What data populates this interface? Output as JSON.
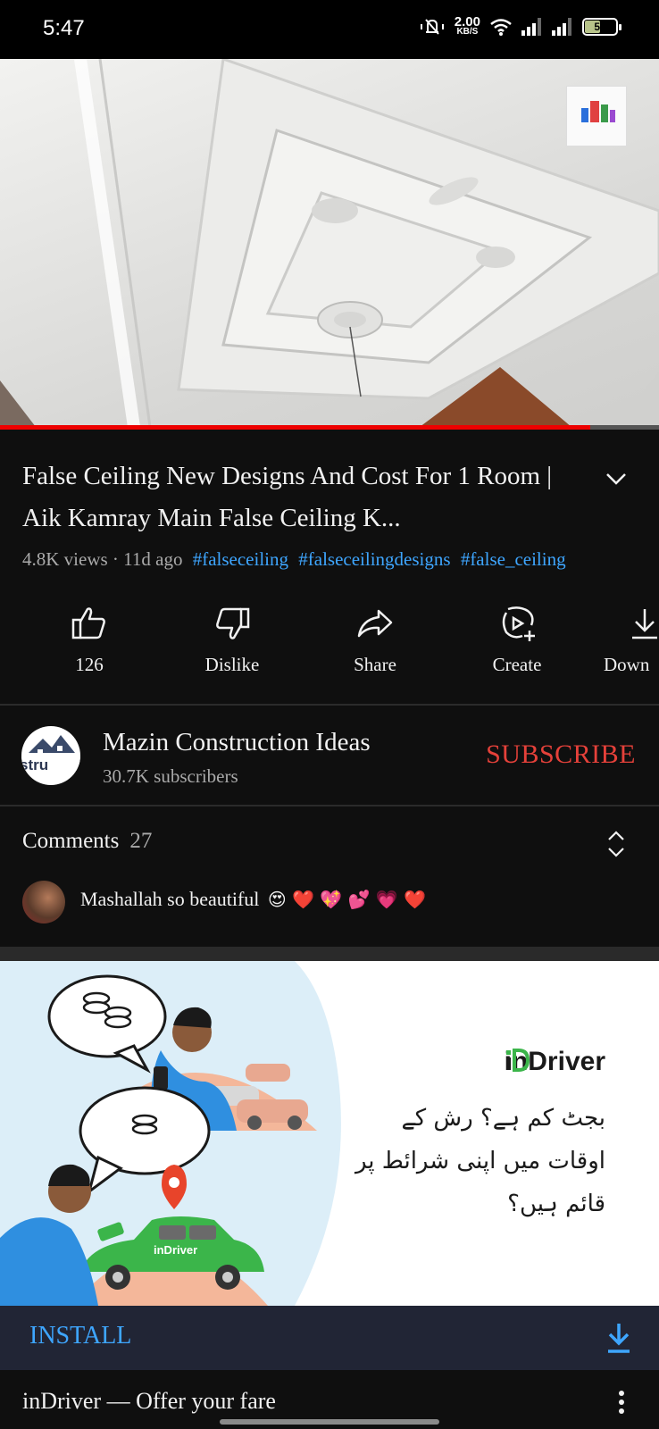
{
  "status_bar": {
    "time": "5:47",
    "net_speed_value": "2.00",
    "net_speed_unit": "KB/S",
    "battery": "53",
    "battery_level": 0.53,
    "icons": [
      "vibrate-mute-icon",
      "wifi-icon",
      "signal-icon",
      "signal-icon",
      "battery-icon"
    ]
  },
  "video": {
    "title": "False Ceiling New Designs And Cost For 1 Room | Aik Kamray Main False Ceiling K...",
    "progress": 0.895,
    "views": "4.8K views",
    "separator": " · ",
    "age": "11d ago",
    "hashtags": [
      "#falseceiling",
      "#falseceilingdesigns",
      "#false_ceiling"
    ]
  },
  "actions": [
    {
      "name": "like",
      "label": "126",
      "icon": "thumbs-up-icon"
    },
    {
      "name": "dislike",
      "label": "Dislike",
      "icon": "thumbs-down-icon"
    },
    {
      "name": "share",
      "label": "Share",
      "icon": "share-icon"
    },
    {
      "name": "create",
      "label": "Create",
      "icon": "create-icon"
    },
    {
      "name": "download",
      "label": "Down",
      "icon": "download-icon"
    }
  ],
  "channel": {
    "name": "Mazin Construction Ideas",
    "subscribers": "30.7K subscribers",
    "subscribe_label": "SUBSCRIBE",
    "avatar_text": "stru"
  },
  "comments": {
    "heading": "Comments",
    "count": "27",
    "top_comment": "Mashallah so beautiful",
    "top_comment_emojis": "😍 ❤️ 💖 💕 💗 ❤️"
  },
  "ad": {
    "brand": "inDriver",
    "headline": "بجٹ کم ہے؟ رش کے اوقات میں اپنی شرائط پر قائم ہیں؟",
    "car_label": "inDriver",
    "install_label": "INSTALL",
    "footer_title": "inDriver — Offer your fare"
  },
  "colors": {
    "background": "#0f0f0f",
    "accent_red": "#e5413a",
    "link_blue": "#3ea6ff",
    "progress_red": "#ee0000",
    "indriver_green": "#3bb54a"
  }
}
